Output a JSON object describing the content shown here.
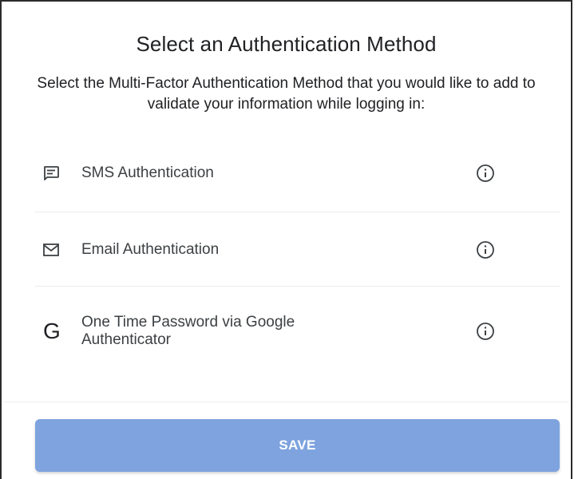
{
  "dialog": {
    "title": "Select an Authentication Method",
    "subtitle": "Select the Multi-Factor Authentication Method that you would like to add to validate your information while logging in:"
  },
  "options": [
    {
      "label": "SMS Authentication",
      "icon": "sms-message-icon",
      "info_icon": "info-icon"
    },
    {
      "label": "Email Authentication",
      "icon": "envelope-icon",
      "info_icon": "info-icon"
    },
    {
      "label": "One Time Password via Google Authenticator",
      "icon": "google-g-icon",
      "icon_glyph": "G",
      "info_icon": "info-icon"
    }
  ],
  "footer": {
    "save_label": "SAVE"
  },
  "colors": {
    "save_button_bg": "#7ea3df",
    "text": "#202124",
    "icon": "#3c4043"
  }
}
